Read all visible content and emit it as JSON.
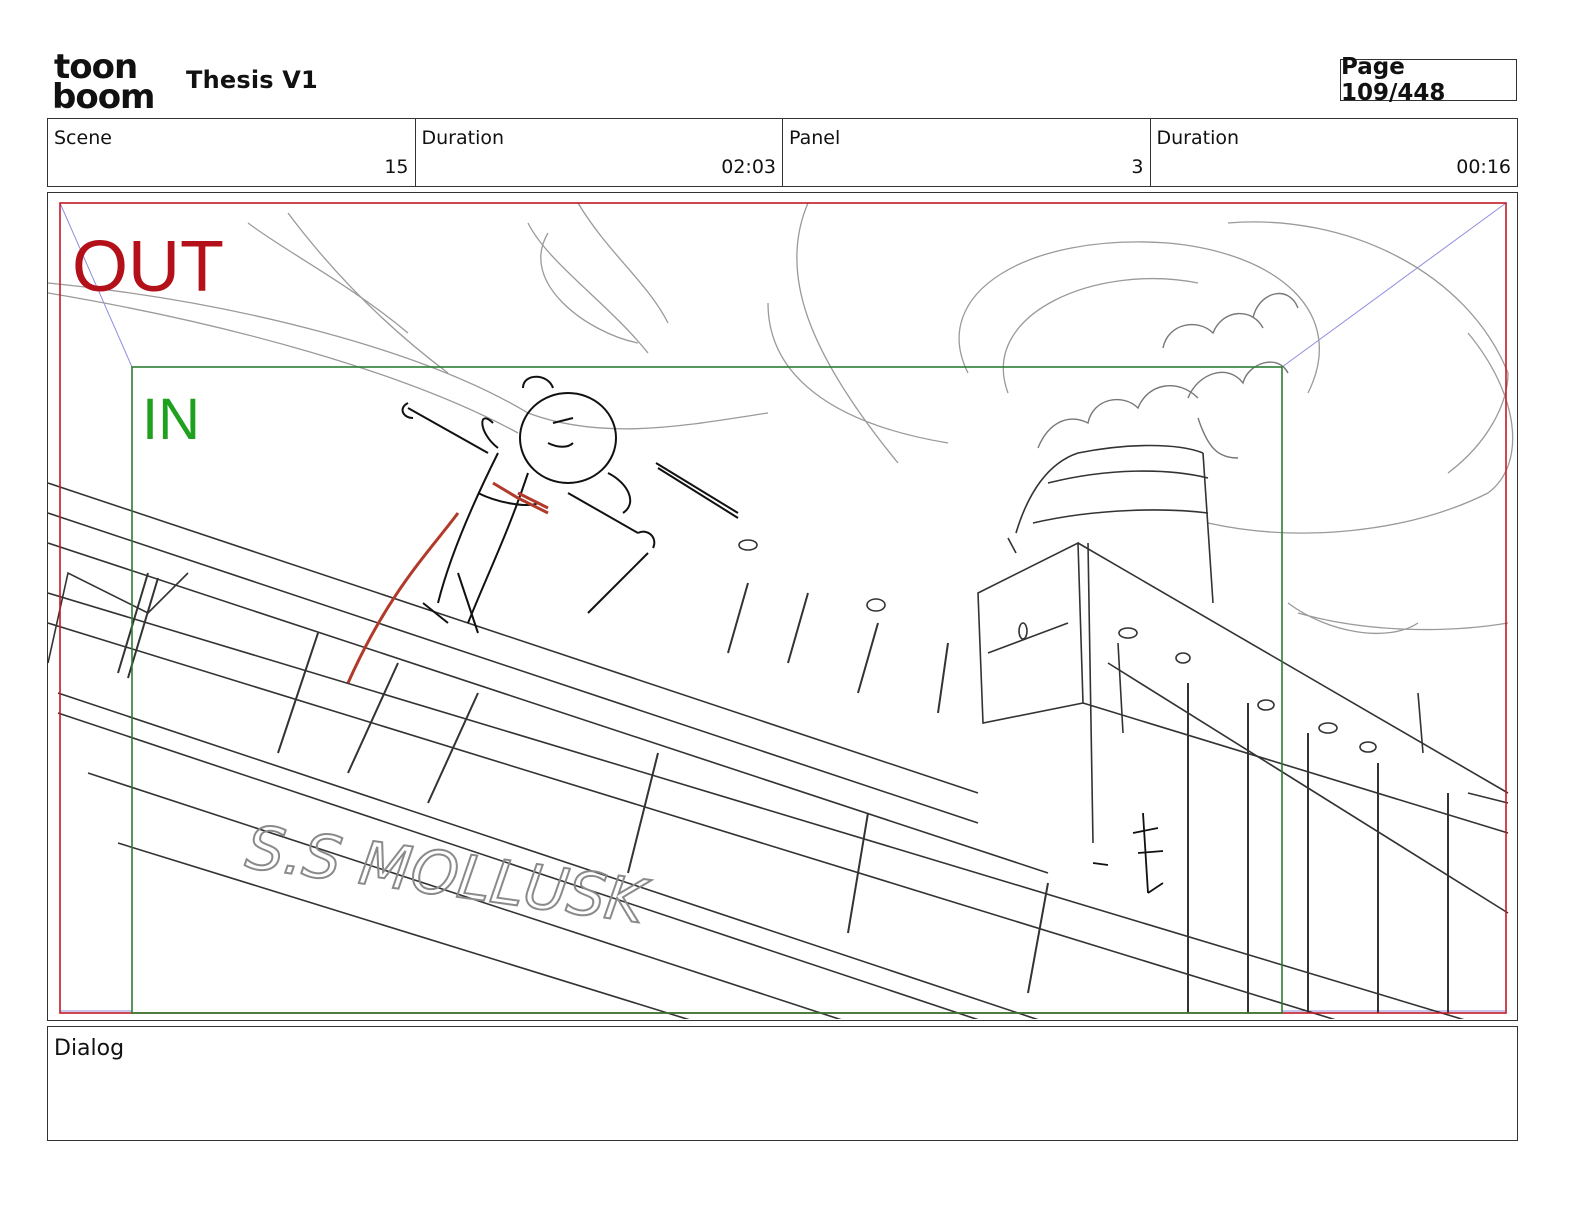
{
  "header": {
    "logo_lines": [
      "toon",
      "boom"
    ],
    "project_title": "Thesis V1",
    "page_indicator": "Page 109/448"
  },
  "info": {
    "scene_label": "Scene",
    "scene_value": "15",
    "scene_duration_label": "Duration",
    "scene_duration_value": "02:03",
    "panel_label": "Panel",
    "panel_value": "3",
    "panel_duration_label": "Duration",
    "panel_duration_value": "00:16"
  },
  "panel": {
    "out_label": "OUT",
    "in_label": "IN",
    "ship_name": "S.S MOLLUSK",
    "colors": {
      "out_frame": "#b3101a",
      "in_frame": "#2e7d32",
      "in_text": "#1fa01f",
      "sketch": "#555555",
      "accent": "#b23a2a"
    }
  },
  "dialog": {
    "label": "Dialog"
  }
}
